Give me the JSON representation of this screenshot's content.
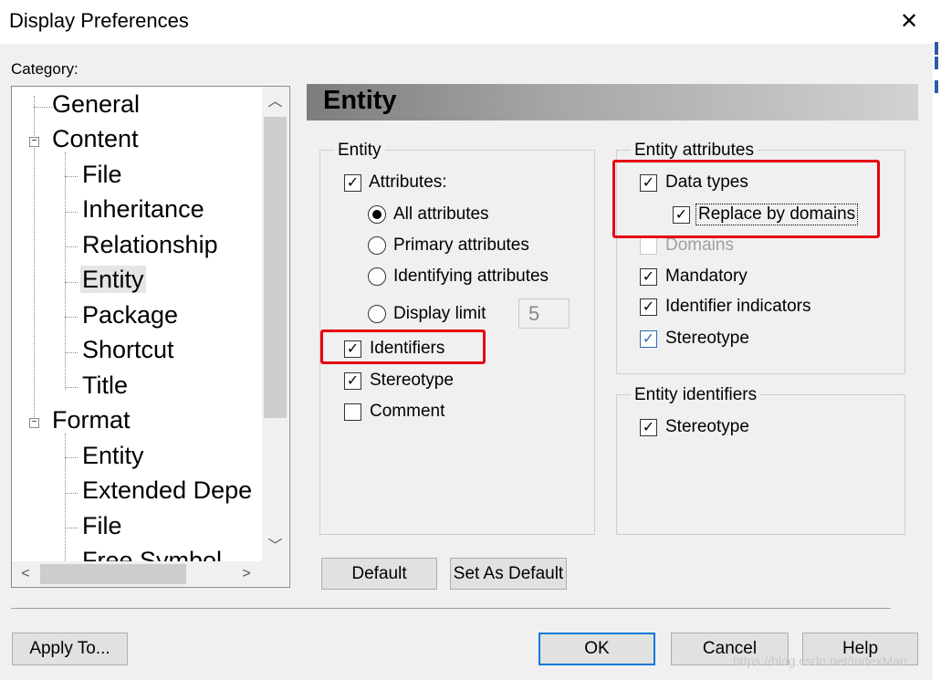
{
  "window": {
    "title": "Display Preferences"
  },
  "category": {
    "label": "Category:",
    "tree": [
      "General",
      "Content",
      "File",
      "Inheritance",
      "Relationship",
      "Entity",
      "Package",
      "Shortcut",
      "Title",
      "Format",
      "Entity",
      "Extended Depe",
      "File",
      "Free Symbol"
    ],
    "selected": "Entity"
  },
  "header": {
    "title": "Entity"
  },
  "entity_group": {
    "legend": "Entity",
    "attributes_label": "Attributes:",
    "radios": [
      "All attributes",
      "Primary attributes",
      "Identifying attributes",
      "Display limit"
    ],
    "display_limit_value": "5",
    "identifiers_label": "Identifiers",
    "stereotype_label": "Stereotype",
    "comment_label": "Comment"
  },
  "entity_attributes_group": {
    "legend": "Entity attributes",
    "items": [
      "Data types",
      "Replace by domains",
      "Domains",
      "Mandatory",
      "Identifier indicators",
      "Stereotype"
    ]
  },
  "entity_identifiers_group": {
    "legend": "Entity identifiers",
    "stereotype_label": "Stereotype"
  },
  "buttons": {
    "default": "Default",
    "set_as_default": "Set As Default",
    "apply_to": "Apply To...",
    "ok": "OK",
    "cancel": "Cancel",
    "help": "Help"
  },
  "watermark": "https://blog.csdn.net/IndexMan",
  "colors": {
    "highlight": "#e60012",
    "accent": "#0078d7"
  }
}
